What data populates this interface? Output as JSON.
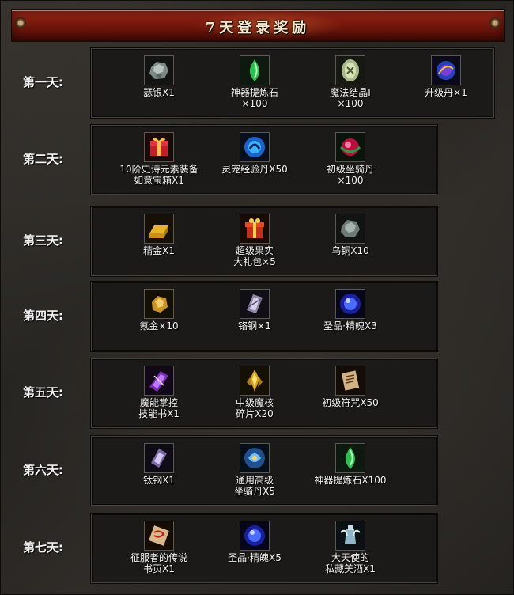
{
  "banner": {
    "title": "7天登录奖励"
  },
  "days": [
    {
      "label": "第一天:",
      "items": [
        {
          "name": "瑟银X1",
          "icon": "thorium-ore-icon"
        },
        {
          "name": "神器提炼石\n×100",
          "icon": "green-refining-stone-icon"
        },
        {
          "name": "魔法结晶Ⅰ\n×100",
          "icon": "magic-crystal-icon"
        },
        {
          "name": "升级丹×1",
          "icon": "level-up-pill-icon"
        }
      ]
    },
    {
      "label": "第二天:",
      "items": [
        {
          "name": "10阶史诗元素装备\n如意宝箱X1",
          "icon": "gift-chest-icon"
        },
        {
          "name": "灵宠经验丹X50",
          "icon": "pet-exp-orb-icon"
        },
        {
          "name": "初级坐骑丹\n×100",
          "icon": "mount-pill-icon"
        }
      ]
    },
    {
      "label": "第三天:",
      "items": [
        {
          "name": "精金X1",
          "icon": "gold-bar-icon"
        },
        {
          "name": "超级果实\n大礼包×5",
          "icon": "gift-box-icon"
        },
        {
          "name": "乌铜X10",
          "icon": "black-copper-ore-icon"
        }
      ]
    },
    {
      "label": "第四天:",
      "items": [
        {
          "name": "氪金×10",
          "icon": "krypton-gold-nugget-icon"
        },
        {
          "name": "铬钢×1",
          "icon": "chrome-steel-icon"
        },
        {
          "name": "圣品·精魄X3",
          "icon": "holy-soul-orb-icon"
        }
      ]
    },
    {
      "label": "第五天:",
      "items": [
        {
          "name": "魔能掌控\n技能书X1",
          "icon": "skill-book-icon"
        },
        {
          "name": "中级魔核\n碎片X20",
          "icon": "magic-core-shard-icon"
        },
        {
          "name": "初级符咒X50",
          "icon": "scroll-charm-icon"
        }
      ]
    },
    {
      "label": "第六天:",
      "items": [
        {
          "name": "钛钢X1",
          "icon": "titanium-steel-icon"
        },
        {
          "name": "通用高级\n坐骑丹X5",
          "icon": "advanced-mount-pill-icon"
        },
        {
          "name": "神器提炼石X100",
          "icon": "green-refining-stone-icon"
        }
      ]
    },
    {
      "label": "第七天:",
      "items": [
        {
          "name": "征服者的传说\n书页X1",
          "icon": "legend-page-scroll-icon"
        },
        {
          "name": "圣品·精魄X5",
          "icon": "holy-soul-orb-icon"
        },
        {
          "name": "大天使的\n私藏美酒X1",
          "icon": "archangel-wine-icon"
        }
      ]
    }
  ]
}
